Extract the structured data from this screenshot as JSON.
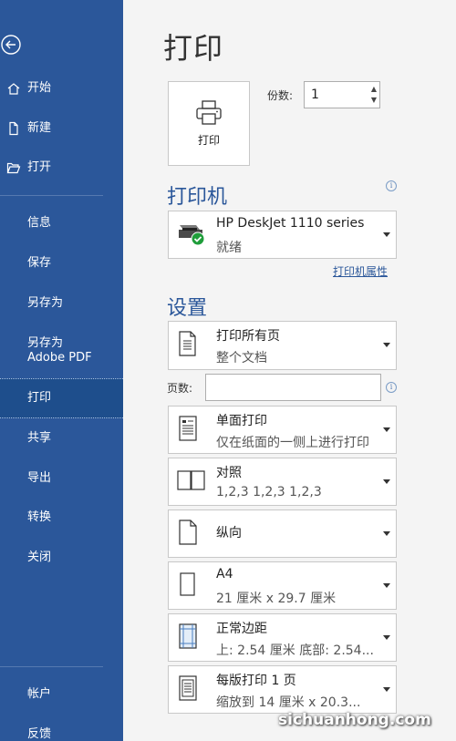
{
  "sidebar": {
    "items": [
      {
        "label": "开始"
      },
      {
        "label": "新建"
      },
      {
        "label": "打开"
      },
      {
        "label": "信息"
      },
      {
        "label": "保存"
      },
      {
        "label": "另存为"
      },
      {
        "label": "另存为 Adobe PDF"
      },
      {
        "label": "打印"
      },
      {
        "label": "共享"
      },
      {
        "label": "导出"
      },
      {
        "label": "转换"
      },
      {
        "label": "关闭"
      },
      {
        "label": "帐户"
      },
      {
        "label": "反馈"
      }
    ]
  },
  "main": {
    "title": "打印",
    "print_button": "打印",
    "copies_label": "份数:",
    "copies_value": "1",
    "printer_heading": "打印机",
    "printer_name": "HP DeskJet 1110 series",
    "printer_status": "就绪",
    "printer_properties": "打印机属性",
    "settings_heading": "设置",
    "pages_label": "页数:",
    "settings": [
      {
        "line1": "打印所有页",
        "line2": "整个文档"
      },
      {
        "line1": "单面打印",
        "line2": "仅在纸面的一侧上进行打印"
      },
      {
        "line1": "对照",
        "line2": "1,2,3    1,2,3    1,2,3"
      },
      {
        "line1": "纵向",
        "line2": ""
      },
      {
        "line1": "A4",
        "line2": "21 厘米 x 29.7 厘米"
      },
      {
        "line1": "正常边距",
        "line2": "上: 2.54 厘米 底部: 2.54..."
      },
      {
        "line1": "每版打印 1 页",
        "line2": "缩放到 14 厘米 x 20.3..."
      }
    ]
  },
  "watermark": "sichuanhong.com",
  "colors": {
    "sidebar": "#2b579a",
    "accent": "#2b579a",
    "status_ok": "#1f9d3a"
  }
}
